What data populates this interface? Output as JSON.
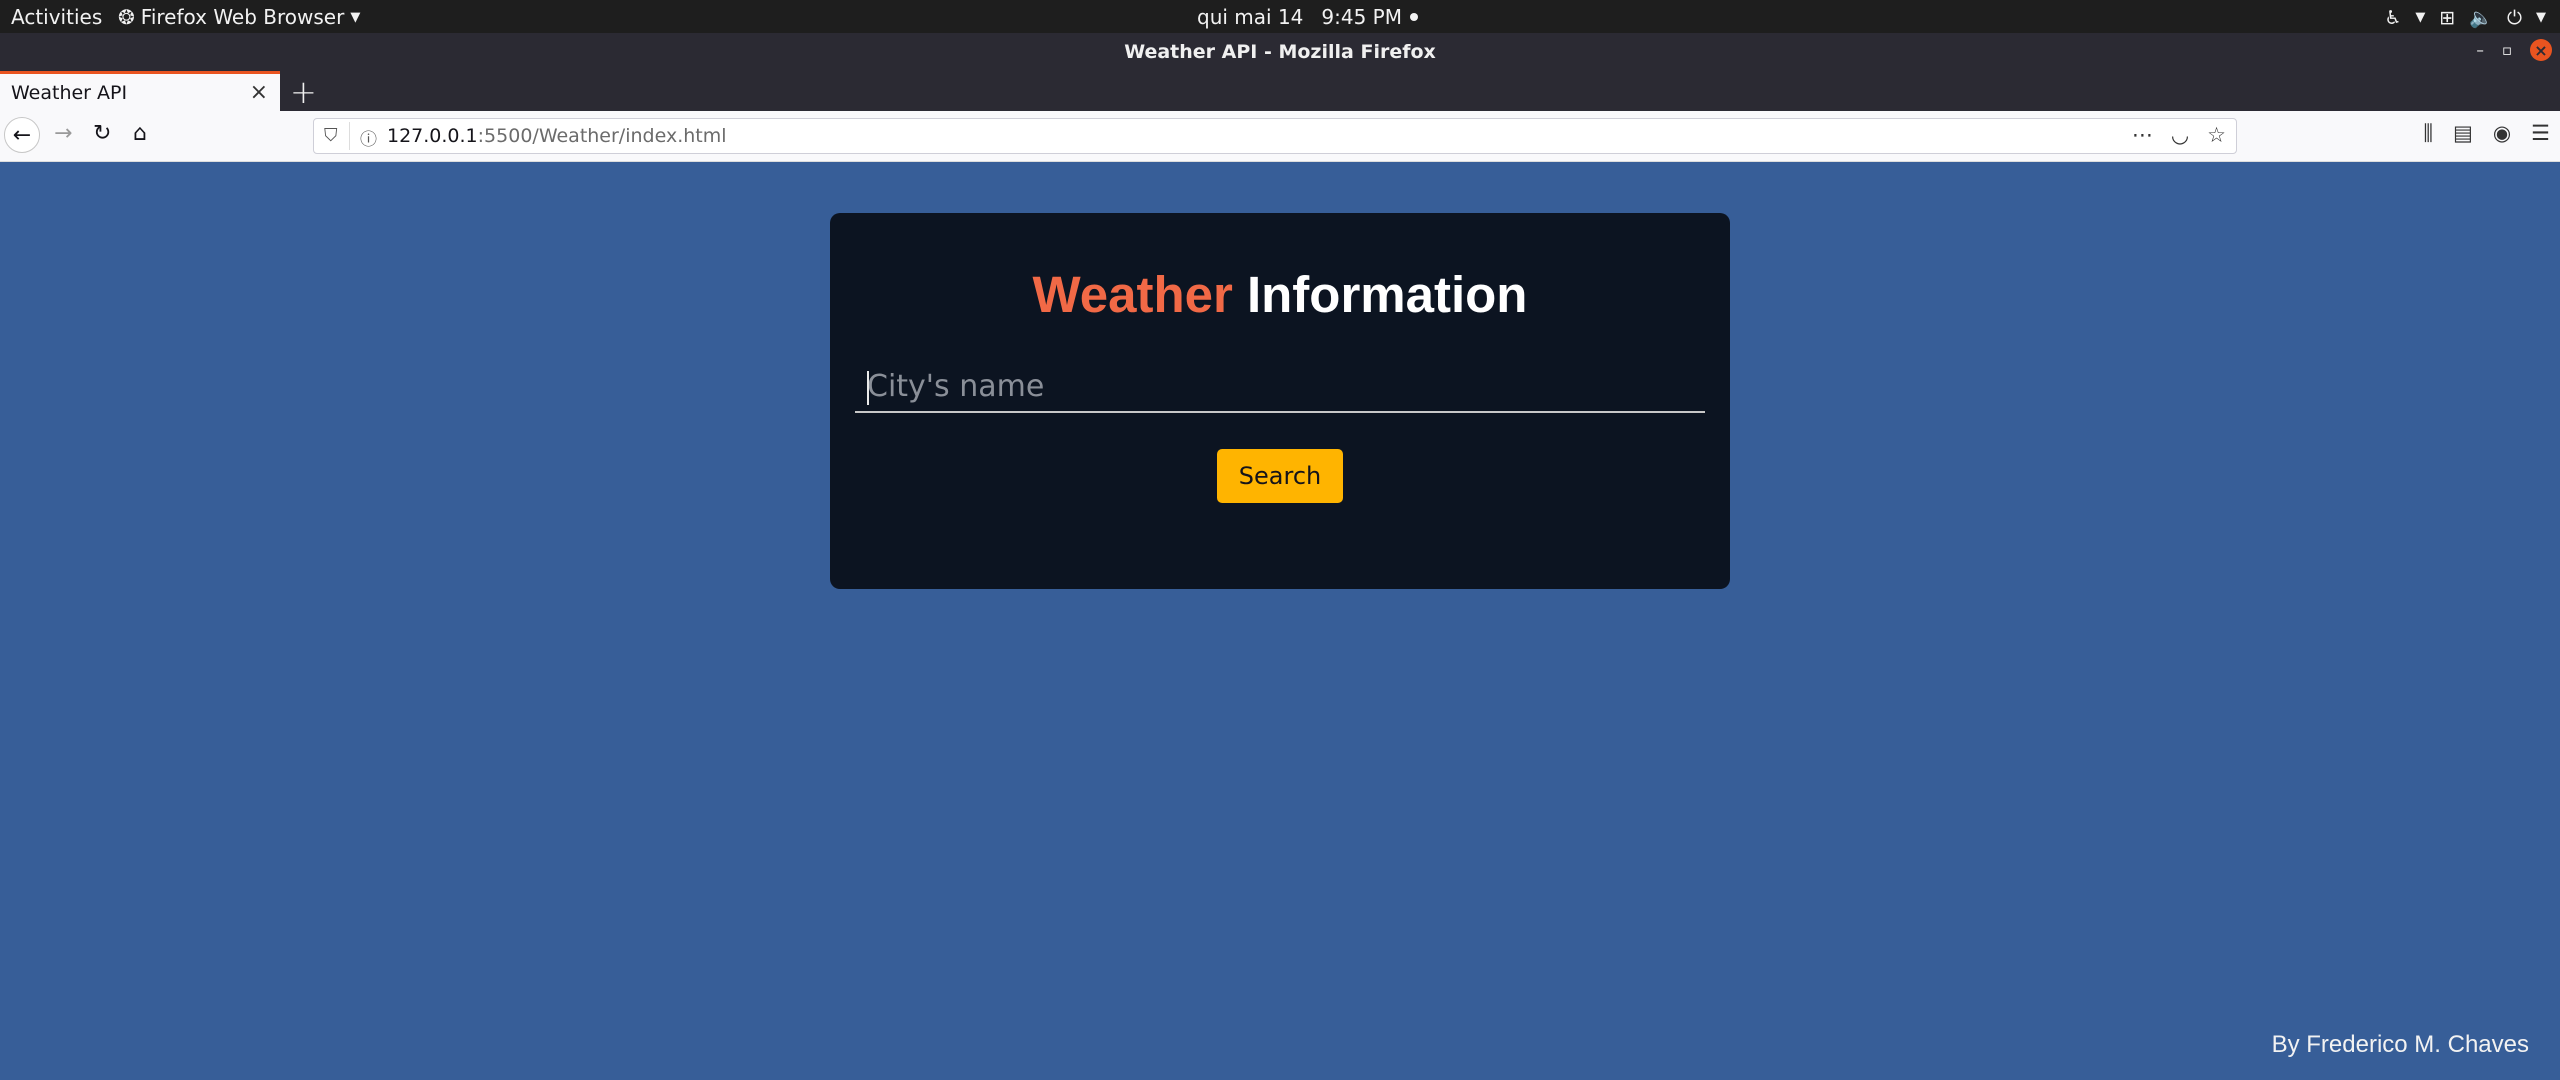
{
  "system_bar": {
    "activities": "Activities",
    "app_menu": "Firefox Web Browser",
    "date": "qui mai 14",
    "time": "9:45 PM"
  },
  "window": {
    "title": "Weather API - Mozilla Firefox"
  },
  "tabs": [
    {
      "label": "Weather API"
    }
  ],
  "urlbar": {
    "host": "127.0.0.1",
    "rest": ":5500/Weather/index.html"
  },
  "page": {
    "heading_accent": "Weather",
    "heading_rest": "Information",
    "city_placeholder": "City's name",
    "city_value": "",
    "search_label": "Search",
    "footer": "By Frederico M. Chaves"
  },
  "colors": {
    "background": "#375e98",
    "card": "#0c1421",
    "accent": "#f16946",
    "button": "#ffb400"
  }
}
